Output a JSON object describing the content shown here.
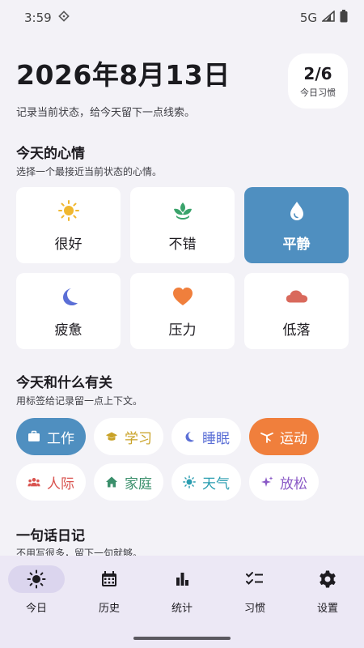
{
  "status_bar": {
    "time": "3:59",
    "network": "5G"
  },
  "header": {
    "date": "2026年8月13日",
    "subtitle": "记录当前状态，给今天留下一点线索。",
    "habit_count": "2/6",
    "habit_label": "今日习惯"
  },
  "mood_section": {
    "title": "今天的心情",
    "desc": "选择一个最接近当前状态的心情。",
    "moods": [
      {
        "label": "很好",
        "icon": "sun-icon",
        "color": "#f0b72f",
        "selected": false
      },
      {
        "label": "不错",
        "icon": "sprout-icon",
        "color": "#3aa36b",
        "selected": false
      },
      {
        "label": "平静",
        "icon": "water-drop-icon",
        "color": "#ffffff",
        "selected": true
      },
      {
        "label": "疲惫",
        "icon": "moon-icon",
        "color": "#5b6fd6",
        "selected": false
      },
      {
        "label": "压力",
        "icon": "heart-icon",
        "color": "#f07f3c",
        "selected": false
      },
      {
        "label": "低落",
        "icon": "cloud-icon",
        "color": "#d9695c",
        "selected": false
      }
    ]
  },
  "tag_section": {
    "title": "今天和什么有关",
    "desc": "用标签给记录留一点上下文。",
    "tags": [
      {
        "label": "工作",
        "icon": "briefcase-icon",
        "color": "#ffffff",
        "selected": true
      },
      {
        "label": "学习",
        "icon": "graduation-cap-icon",
        "color": "#c9a227",
        "selected": false
      },
      {
        "label": "睡眠",
        "icon": "moon-icon",
        "color": "#5b6fd6",
        "selected": false
      },
      {
        "label": "运动",
        "icon": "sport-icon",
        "color": "#ffffff",
        "selected": true
      },
      {
        "label": "人际",
        "icon": "people-icon",
        "color": "#d9534f",
        "selected": false
      },
      {
        "label": "家庭",
        "icon": "home-icon",
        "color": "#3a8f6b",
        "selected": false
      },
      {
        "label": "天气",
        "icon": "sun-icon",
        "color": "#2a9db0",
        "selected": false
      },
      {
        "label": "放松",
        "icon": "sparkle-icon",
        "color": "#8a59c6",
        "selected": false
      }
    ]
  },
  "journal_section": {
    "title": "一句话日记",
    "desc": "不用写很多，留下一句就够。"
  },
  "nav": {
    "items": [
      {
        "label": "今日",
        "icon": "sun-icon",
        "active": true
      },
      {
        "label": "历史",
        "icon": "calendar-icon",
        "active": false
      },
      {
        "label": "统计",
        "icon": "bar-chart-icon",
        "active": false
      },
      {
        "label": "习惯",
        "icon": "checklist-icon",
        "active": false
      },
      {
        "label": "设置",
        "icon": "gear-icon",
        "active": false
      }
    ]
  }
}
